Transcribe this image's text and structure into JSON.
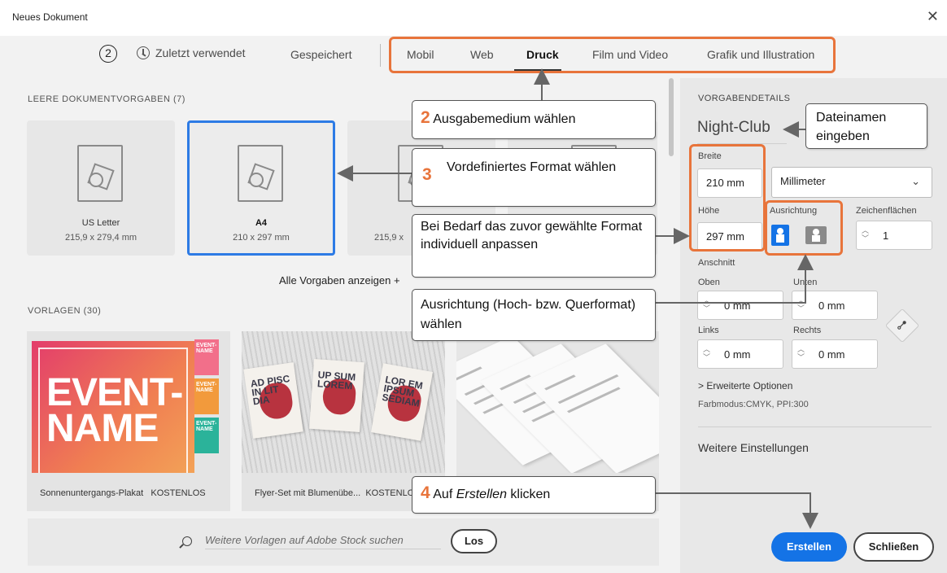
{
  "window": {
    "title": "Neues Dokument",
    "close_glyph": "✕"
  },
  "nav": {
    "step_badge": "2",
    "recent": "Zuletzt verwendet",
    "saved": "Gespeichert",
    "tabs": [
      {
        "label": "Mobil",
        "active": false
      },
      {
        "label": "Web",
        "active": false
      },
      {
        "label": "Druck",
        "active": true
      },
      {
        "label": "Film und Video",
        "active": false
      },
      {
        "label": "Grafik und Illustration",
        "active": false
      }
    ]
  },
  "presets": {
    "heading": "LEERE DOKUMENTVORGABEN  (7)",
    "items": [
      {
        "name": "US Letter",
        "size": "215,9 x 279,4 mm"
      },
      {
        "name": "A4",
        "size": "210 x 297 mm"
      },
      {
        "name": "",
        "size": "215,9 x"
      }
    ],
    "show_all": "Alle Vorgaben anzeigen  +"
  },
  "templates": {
    "heading": "VORLAGEN  (30)",
    "items": [
      {
        "label": "Sonnenuntergangs-Plakat",
        "badge": "KOSTENLOS",
        "poster_text": "EVENT-\nNAME"
      },
      {
        "label": "Flyer-Set mit Blumenübe...",
        "badge": "KOSTENLOS",
        "flyer_words": [
          "AD PISC IN LIT DIA",
          "UP SUM LOREM",
          "LOR EM IPSUM SEDIAM"
        ]
      },
      {
        "label": "",
        "badge": ""
      }
    ],
    "mini_poster_text": "EVENT-NAME"
  },
  "search": {
    "placeholder": "Weitere Vorlagen auf Adobe Stock suchen",
    "go_button": "Los"
  },
  "details": {
    "heading": "VORGABENDETAILS",
    "doc_name": "Night-Club",
    "width_label": "Breite",
    "width_value": "210 mm",
    "unit_value": "Millimeter",
    "height_label": "Höhe",
    "height_value": "297 mm",
    "orientation_label": "Ausrichtung",
    "artboards_label": "Zeichenflächen",
    "artboards_value": "1",
    "bleed_label": "Anschnitt",
    "top_label": "Oben",
    "top_value": "0 mm",
    "bottom_label": "Unten",
    "bottom_value": "0 mm",
    "left_label": "Links",
    "left_value": "0 mm",
    "right_label": "Rechts",
    "right_value": "0 mm",
    "advanced": "> Erweiterte Optionen",
    "color_mode": "Farbmodus:CMYK, PPI:300",
    "more_settings": "Weitere Einstellungen",
    "create_button": "Erstellen",
    "close_button": "Schließen"
  },
  "callouts": {
    "c2_num": "2",
    "c2_text": "Ausgabemedium wählen",
    "c3_num": "3",
    "c3_text": "Vordefiniertes Format wählen",
    "custom": "Bei Bedarf das zuvor gewählte Format individuell anpassen",
    "orientation": "Ausrichtung (Hoch- bzw. Querformat) wählen",
    "filename": "Dateinamen eingeben",
    "c4_num": "4",
    "c4_pre": "Auf ",
    "c4_em": "Erstellen",
    "c4_post": " klicken"
  },
  "colors": {
    "accent": "#1473e6",
    "annotation": "#e8743b",
    "selected_border": "#2d7be5"
  }
}
